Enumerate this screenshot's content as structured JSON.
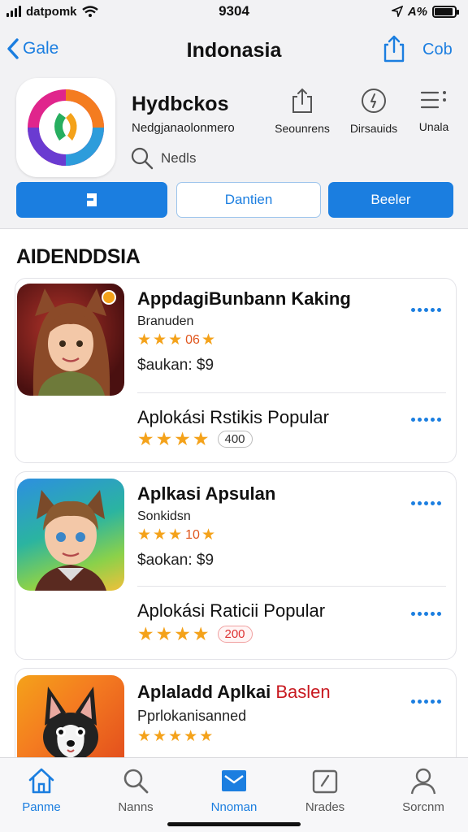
{
  "status_bar": {
    "carrier": "datpomk",
    "time": "9304",
    "battery_text": "A%",
    "battery_level": 0.9
  },
  "nav": {
    "back_label": "Gale",
    "title": "Indonasia",
    "right_label": "Cob"
  },
  "app": {
    "name": "Hydbckos",
    "subtitle": "Nedgjanaolonmero",
    "search_text": "Nedls",
    "actions": [
      {
        "label": "Seounrens",
        "icon": "share-icon"
      },
      {
        "label": "Dirsauids",
        "icon": "info-icon"
      },
      {
        "label": "Unala",
        "icon": "list-icon"
      }
    ]
  },
  "buttons": {
    "left_label": "",
    "middle_label": "Dantien",
    "right_label": "Beeler"
  },
  "section": {
    "title": "AIDENDDSIA"
  },
  "cards": [
    {
      "title": "AppdagiBunbann Kaking",
      "subtitle": "Branuden",
      "rating_text": "06",
      "price": "$aukan: $9",
      "row2_title": "Aplokási  Rstikis Popular",
      "row2_rating": "400"
    },
    {
      "title": "Aplkasi Apsulan",
      "subtitle": "Sonkidsn",
      "rating_text": "10",
      "price": "$aokan: $9",
      "row2_title": "Aplokási  Raticii Popular",
      "row2_rating": "200"
    },
    {
      "title_black": "Aplaladd Aplkai",
      "title_red": "Baslen",
      "subtitle": "Pprlokanisanned"
    }
  ],
  "tabs": [
    {
      "label": "Panme",
      "icon": "home-icon",
      "active": true
    },
    {
      "label": "Nanns",
      "icon": "search-icon",
      "active": false
    },
    {
      "label": "Nnoman",
      "icon": "mail-icon",
      "active": false
    },
    {
      "label": "Nrades",
      "icon": "updates-icon",
      "active": false
    },
    {
      "label": "Sorcnm",
      "icon": "person-icon",
      "active": false
    }
  ],
  "colors": {
    "accent": "#1b7ee0",
    "star": "#f4a21a",
    "header_bg": "#f2f2f4"
  }
}
